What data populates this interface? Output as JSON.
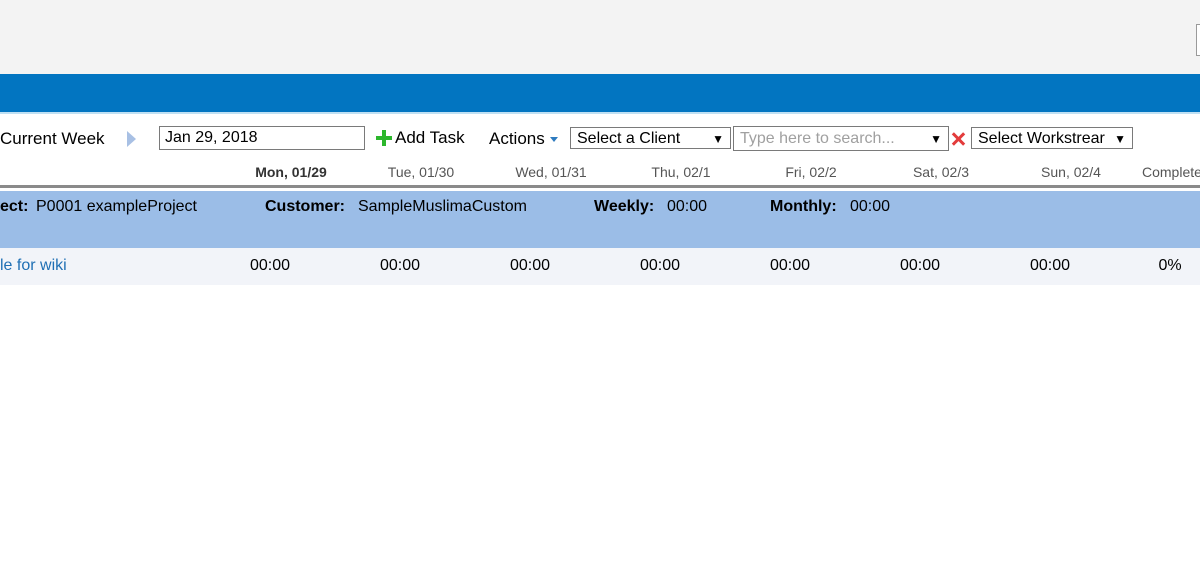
{
  "toolbar": {
    "week_label": "Current Week",
    "date_value": "Jan 29, 2018",
    "add_task_label": "Add Task",
    "actions_label": "Actions",
    "client_select": "Select a Client",
    "search_placeholder": "Type here to search...",
    "workstream_select": "Select Workstrear"
  },
  "days": [
    "Mon, 01/29",
    "Tue, 01/30",
    "Wed, 01/31",
    "Thu, 02/1",
    "Fri, 02/2",
    "Sat, 02/3",
    "Sun, 02/4"
  ],
  "complete_header": "Complete",
  "project": {
    "label": "ect:",
    "value": "P0001 exampleProject",
    "customer_label": "Customer:",
    "customer_value": "SampleMuslimaCustom",
    "weekly_label": "Weekly:",
    "weekly_value": "00:00",
    "monthly_label": "Monthly:",
    "monthly_value": "00:00"
  },
  "task": {
    "name": "le for wiki",
    "hours": [
      "00:00",
      "00:00",
      "00:00",
      "00:00",
      "00:00",
      "00:00",
      "00:00"
    ],
    "complete": "0%"
  }
}
